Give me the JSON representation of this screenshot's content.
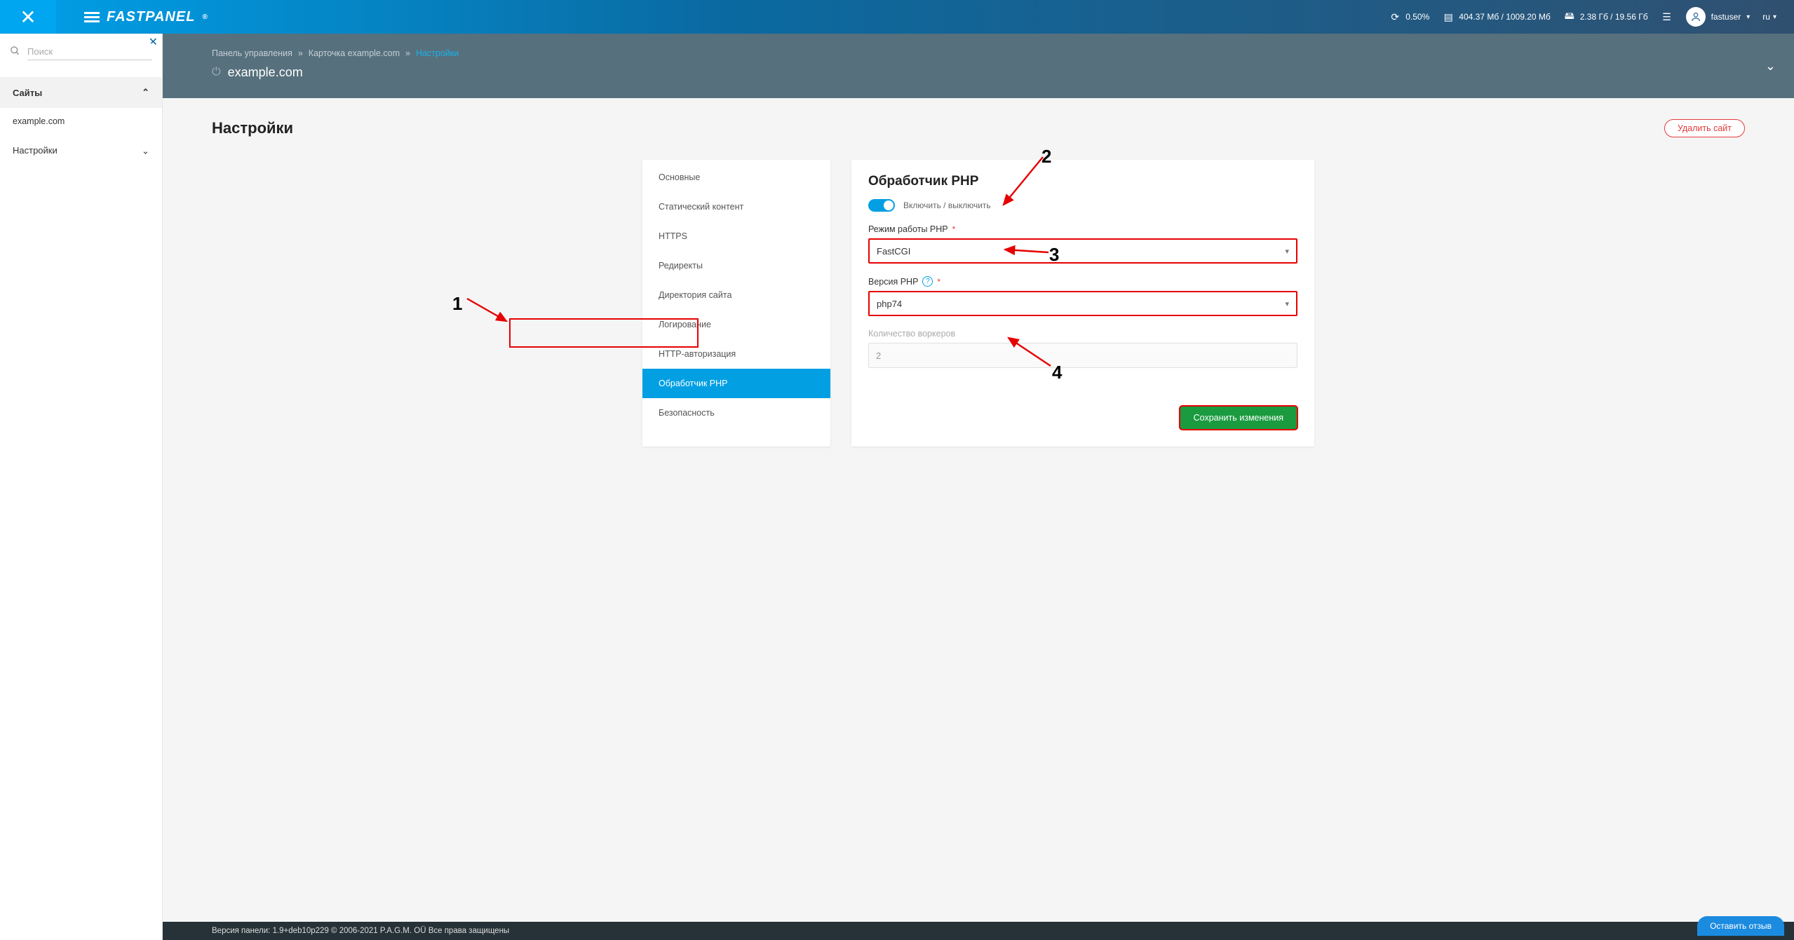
{
  "header": {
    "logo_text": "FASTPANEL",
    "cpu_label": "0.50%",
    "ram_label": "404.37 Мб / 1009.20 Мб",
    "disk_label": "2.38 Гб / 19.56 Гб",
    "username": "fastuser",
    "lang": "ru"
  },
  "sidebar": {
    "search_placeholder": "Поиск",
    "group_sites": "Сайты",
    "site_item": "example.com",
    "group_settings": "Настройки"
  },
  "subheader": {
    "crumb_dashboard": "Панель управления",
    "crumb_card": "Карточка example.com",
    "crumb_active": "Настройки",
    "domain": "example.com"
  },
  "page": {
    "title": "Настройки",
    "delete_btn": "Удалить сайт"
  },
  "settings_nav": {
    "items": [
      "Основные",
      "Статический контент",
      "HTTPS",
      "Редиректы",
      "Директория сайта",
      "Логирование",
      "HTTP-авторизация",
      "Обработчик PHP",
      "Безопасность"
    ],
    "active_index": 7
  },
  "form": {
    "panel_title": "Обработчик PHP",
    "toggle_label": "Включить / выключить",
    "mode_label": "Режим работы PHP",
    "mode_value": "FastCGI",
    "version_label": "Версия PHP",
    "version_value": "php74",
    "workers_label": "Количество воркеров",
    "workers_value": "2",
    "save_btn": "Сохранить изменения"
  },
  "footer": {
    "text": "Версия панели: 1.9+deb10p229 © 2006-2021 P.A.G.M. OÜ Все права защищены",
    "feedback": "Оставить отзыв"
  },
  "annotations": {
    "n1": "1",
    "n2": "2",
    "n3": "3",
    "n4": "4"
  }
}
